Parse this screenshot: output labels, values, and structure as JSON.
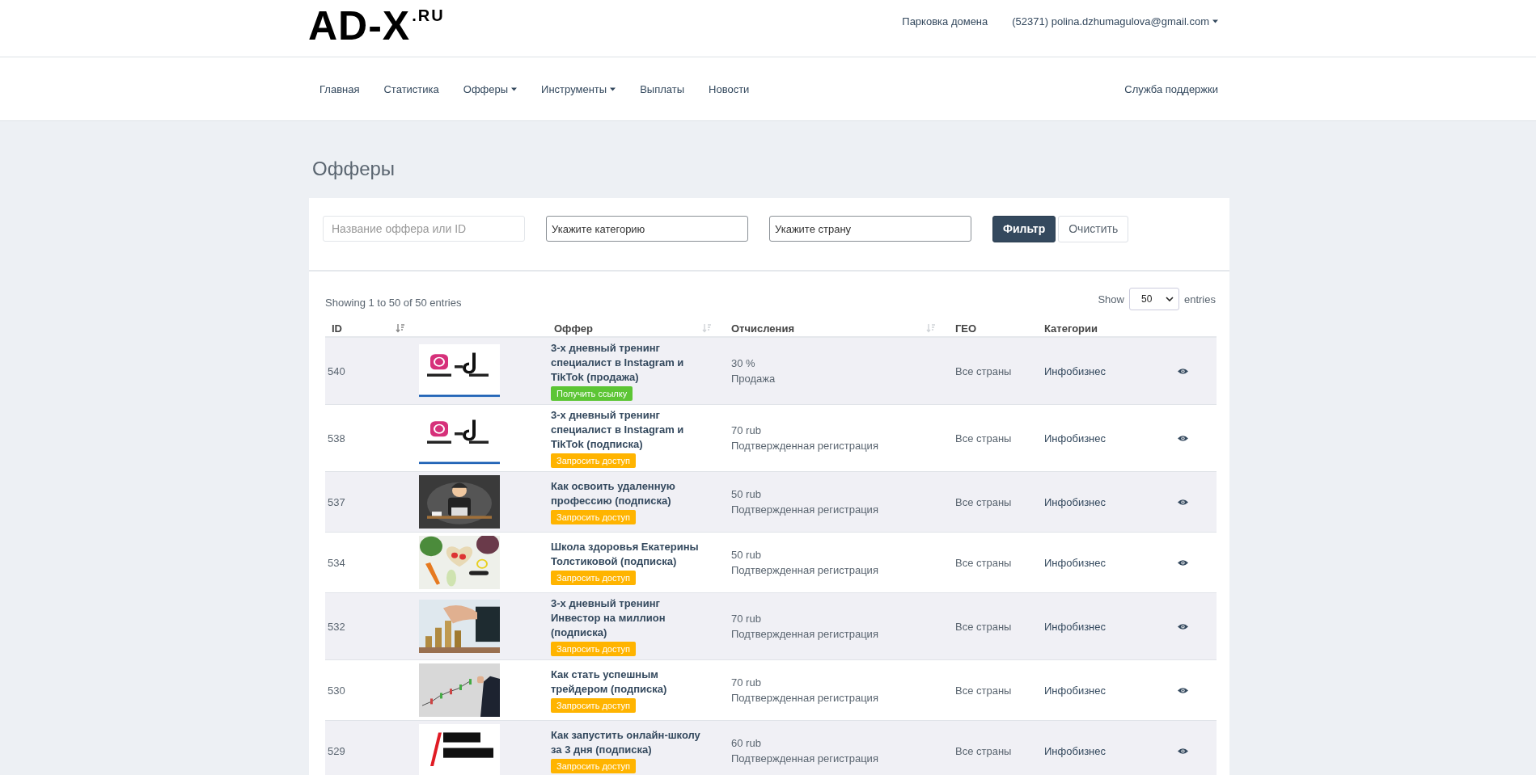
{
  "header": {
    "logo": {
      "main": "AD-X",
      "suffix": ".RU"
    },
    "links": [
      {
        "label": "Парковка домена",
        "has_menu": false
      },
      {
        "label": "(52371) polina.dzhumagulova@gmail.com",
        "has_menu": true
      }
    ]
  },
  "nav": {
    "items": [
      {
        "label": "Главная",
        "has_menu": false
      },
      {
        "label": "Статистика",
        "has_menu": false
      },
      {
        "label": "Офферы",
        "has_menu": true
      },
      {
        "label": "Инструменты",
        "has_menu": true
      },
      {
        "label": "Выплаты",
        "has_menu": false
      },
      {
        "label": "Новости",
        "has_menu": false
      }
    ],
    "support": "Служба поддержки"
  },
  "page_title": "Офферы",
  "filters": {
    "search": {
      "placeholder": "Название оффера или ID"
    },
    "category": {
      "placeholder": "Укажите категорию"
    },
    "country": {
      "placeholder": "Укажите страну"
    },
    "buttons": [
      {
        "label": "Фильтр",
        "kind": "primary"
      },
      {
        "label": "Очистить",
        "kind": "secondary"
      }
    ]
  },
  "table": {
    "info": "Showing 1 to 50 of 50 entries",
    "length": {
      "before": "Show",
      "value": "50",
      "after": "entries"
    },
    "columns": [
      {
        "label": "ID",
        "sortable": true,
        "sorted": true
      },
      {
        "label": "Оффер",
        "sortable": true,
        "sorted": false
      },
      {
        "label": "Отчисления",
        "sortable": true,
        "sorted": false
      },
      {
        "label": "ГЕО",
        "sortable": false
      },
      {
        "label": "Категории",
        "sortable": false
      }
    ],
    "rows": [
      {
        "id": "540",
        "title": "3-х дневный тренинг специалист в Instagram и TikTok (продажа)",
        "action": {
          "label": "Получить ссылку",
          "kind": "get_link"
        },
        "payout": "30 %",
        "payout_type": "Продажа",
        "geo": "Все страны",
        "category": "Инфобизнес"
      },
      {
        "id": "538",
        "title": "3-х дневный тренинг специалист в Instagram и TikTok (подписка)",
        "action": {
          "label": "Запросить доступ",
          "kind": "request"
        },
        "payout": "70 rub",
        "payout_type": "Подтвержденная регистрация",
        "geo": "Все страны",
        "category": "Инфобизнес"
      },
      {
        "id": "537",
        "title": "Как освоить удаленную профессию (подписка)",
        "action": {
          "label": "Запросить доступ",
          "kind": "request"
        },
        "payout": "50 rub",
        "payout_type": "Подтвержденная регистрация",
        "geo": "Все страны",
        "category": "Инфобизнес"
      },
      {
        "id": "534",
        "title": "Школа здоровья Екатерины Толстиковой (подписка)",
        "action": {
          "label": "Запросить доступ",
          "kind": "request"
        },
        "payout": "50 rub",
        "payout_type": "Подтвержденная регистрация",
        "geo": "Все страны",
        "category": "Инфобизнес"
      },
      {
        "id": "532",
        "title": "3-х дневный тренинг Инвестор на миллион (подписка)",
        "action": {
          "label": "Запросить доступ",
          "kind": "request"
        },
        "payout": "70 rub",
        "payout_type": "Подтвержденная регистрация",
        "geo": "Все страны",
        "category": "Инфобизнес"
      },
      {
        "id": "530",
        "title": "Как стать успешным трейдером (подписка)",
        "action": {
          "label": "Запросить доступ",
          "kind": "request"
        },
        "payout": "70 rub",
        "payout_type": "Подтвержденная регистрация",
        "geo": "Все страны",
        "category": "Инфобизнес"
      },
      {
        "id": "529",
        "title": "Как запустить онлайн-школу за 3 дня (подписка)",
        "action": {
          "label": "Запросить доступ",
          "kind": "request"
        },
        "payout": "60 rub",
        "payout_type": "Подтвержденная регистрация",
        "geo": "Все страны",
        "category": "Инфобизнес"
      }
    ]
  }
}
